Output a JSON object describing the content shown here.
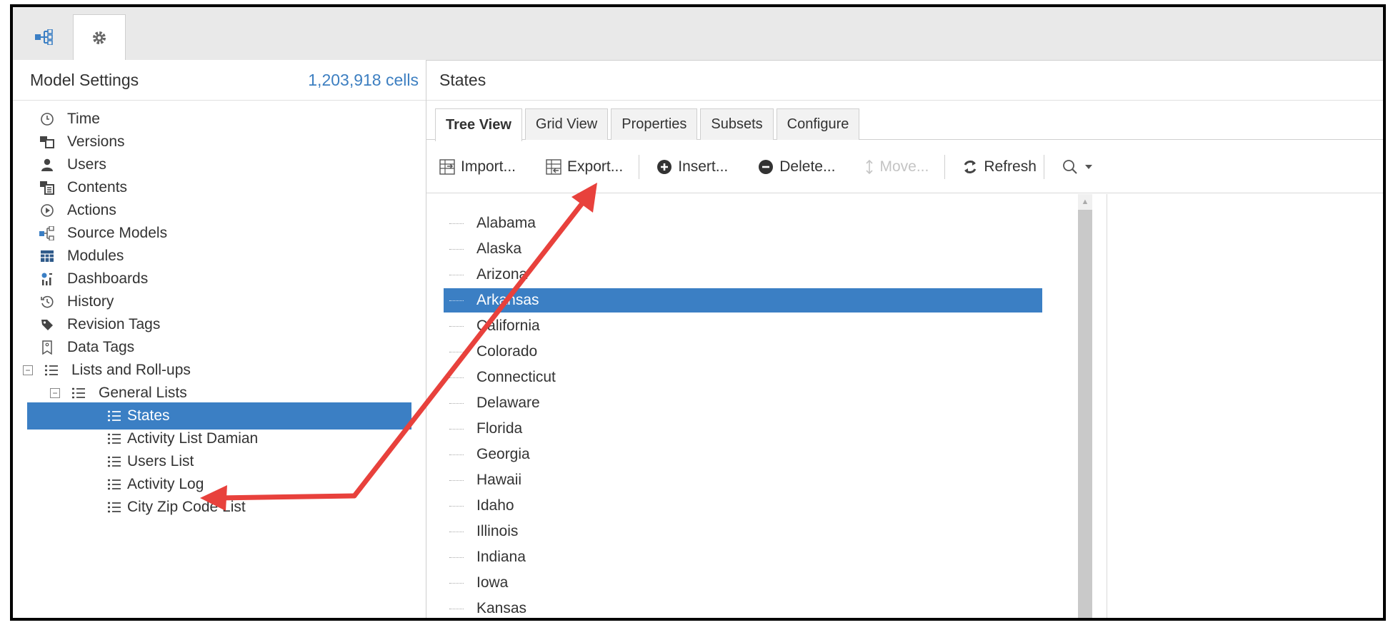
{
  "top_tabs": [
    {
      "icon": "model-tree-icon"
    },
    {
      "icon": "gear-icon"
    }
  ],
  "left_panel": {
    "title": "Model Settings",
    "cell_count": "1,203,918 cells",
    "items": [
      {
        "label": "Time",
        "icon": "clock-icon"
      },
      {
        "label": "Versions",
        "icon": "versions-icon"
      },
      {
        "label": "Users",
        "icon": "user-icon"
      },
      {
        "label": "Contents",
        "icon": "contents-icon"
      },
      {
        "label": "Actions",
        "icon": "play-circle-icon"
      },
      {
        "label": "Source Models",
        "icon": "source-models-icon"
      },
      {
        "label": "Modules",
        "icon": "modules-grid-icon"
      },
      {
        "label": "Dashboards",
        "icon": "dashboards-icon"
      },
      {
        "label": "History",
        "icon": "history-icon"
      },
      {
        "label": "Revision Tags",
        "icon": "tag-icon"
      },
      {
        "label": "Data Tags",
        "icon": "data-tag-icon"
      },
      {
        "label": "Lists and Roll-ups",
        "icon": "list-icon",
        "expander": "−"
      },
      {
        "label": "General Lists",
        "icon": "list-icon",
        "expander": "−"
      },
      {
        "label": "States",
        "icon": "list-icon",
        "selected": true
      },
      {
        "label": "Activity List Damian",
        "icon": "list-icon"
      },
      {
        "label": "Users List",
        "icon": "list-icon"
      },
      {
        "label": "Activity Log",
        "icon": "list-icon"
      },
      {
        "label": "City Zip Code List",
        "icon": "list-icon"
      }
    ]
  },
  "right_panel": {
    "title": "States",
    "tabs": [
      "Tree View",
      "Grid View",
      "Properties",
      "Subsets",
      "Configure"
    ],
    "active_tab": "Tree View",
    "toolbar": {
      "import": "Import...",
      "export": "Export...",
      "insert": "Insert...",
      "delete": "Delete...",
      "move": "Move...",
      "refresh": "Refresh"
    },
    "list": [
      "Alabama",
      "Alaska",
      "Arizona",
      "Arkansas",
      "California",
      "Colorado",
      "Connecticut",
      "Delaware",
      "Florida",
      "Georgia",
      "Hawaii",
      "Idaho",
      "Illinois",
      "Indiana",
      "Iowa",
      "Kansas"
    ],
    "selected_item": "Arkansas"
  },
  "colors": {
    "accent": "#3b7fc4",
    "annotation_arrow": "#e8413c",
    "cell_count_text": "#3d7fc1"
  }
}
